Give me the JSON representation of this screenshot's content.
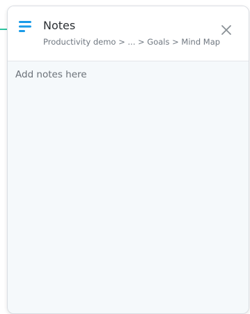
{
  "panel": {
    "title": "Notes",
    "breadcrumb": "Productivity demo > ... > Goals > Mind Map",
    "icon": "notes-lines-icon",
    "close_icon": "close-icon"
  },
  "notes": {
    "value": "",
    "placeholder": "Add notes here"
  },
  "colors": {
    "accent": "#1a9be8",
    "connector": "#2ec4a0"
  }
}
